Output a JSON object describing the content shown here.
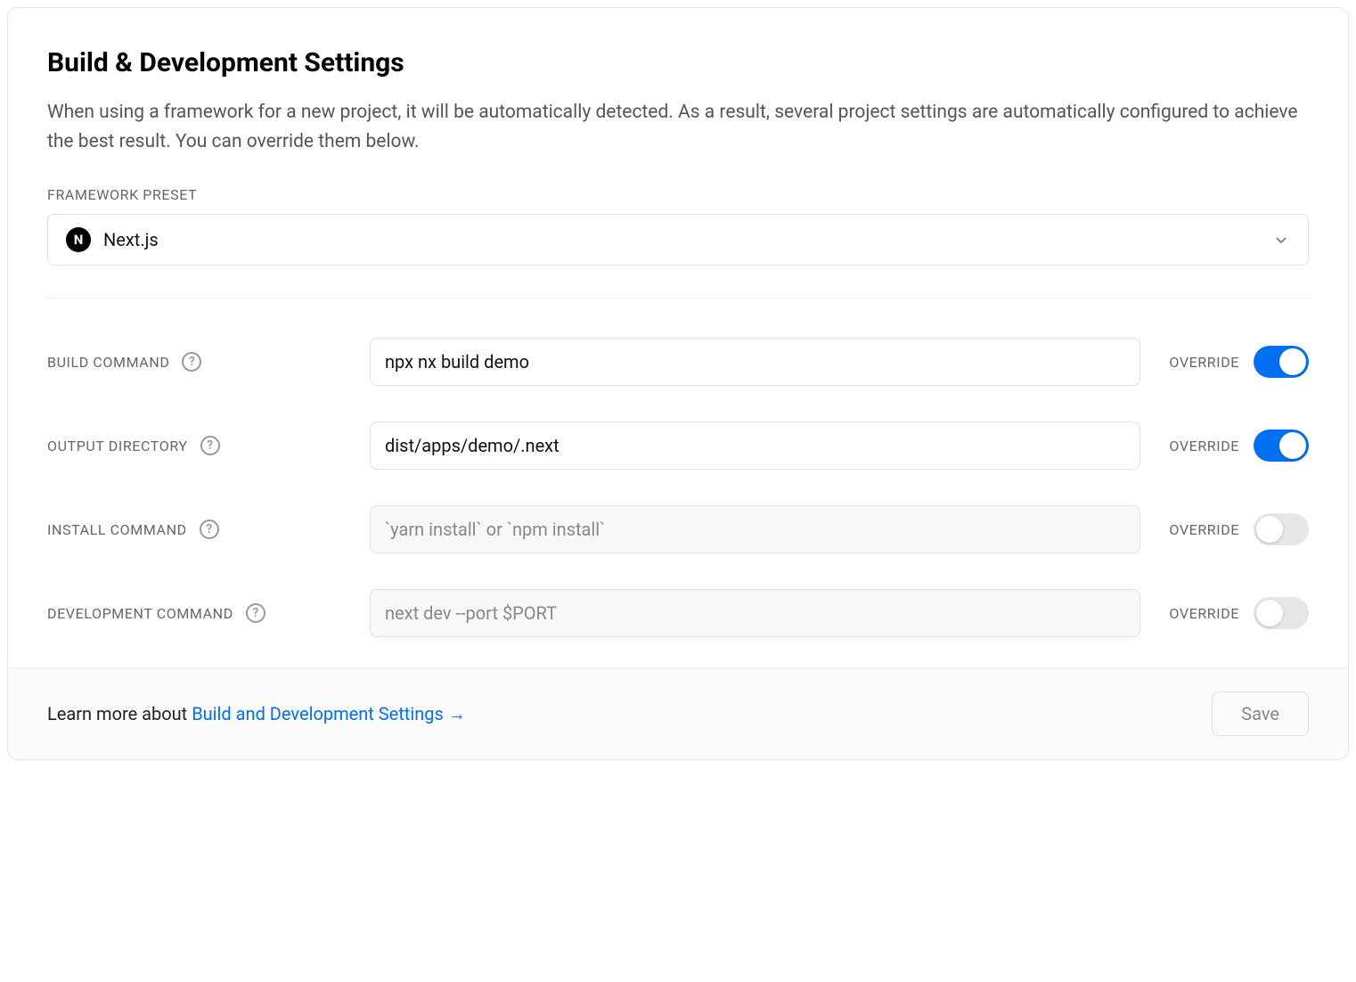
{
  "header": {
    "title": "Build & Development Settings",
    "description": "When using a framework for a new project, it will be automatically detected. As a result, several project settings are automatically configured to achieve the best result. You can override them below."
  },
  "framework": {
    "label": "FRAMEWORK PRESET",
    "selected": "Next.js",
    "icon_letter": "N"
  },
  "override_label": "OVERRIDE",
  "settings": {
    "build_command": {
      "label": "BUILD COMMAND",
      "value": "npx nx build demo",
      "placeholder": "",
      "override": true
    },
    "output_directory": {
      "label": "OUTPUT DIRECTORY",
      "value": "dist/apps/demo/.next",
      "placeholder": "",
      "override": true
    },
    "install_command": {
      "label": "INSTALL COMMAND",
      "value": "",
      "placeholder": "`yarn install` or `npm install`",
      "override": false
    },
    "development_command": {
      "label": "DEVELOPMENT COMMAND",
      "value": "",
      "placeholder": "next dev --port $PORT",
      "override": false
    }
  },
  "footer": {
    "learn_more_prefix": "Learn more about ",
    "link_text": "Build and Development Settings ",
    "link_arrow": "→",
    "save_button": "Save"
  }
}
